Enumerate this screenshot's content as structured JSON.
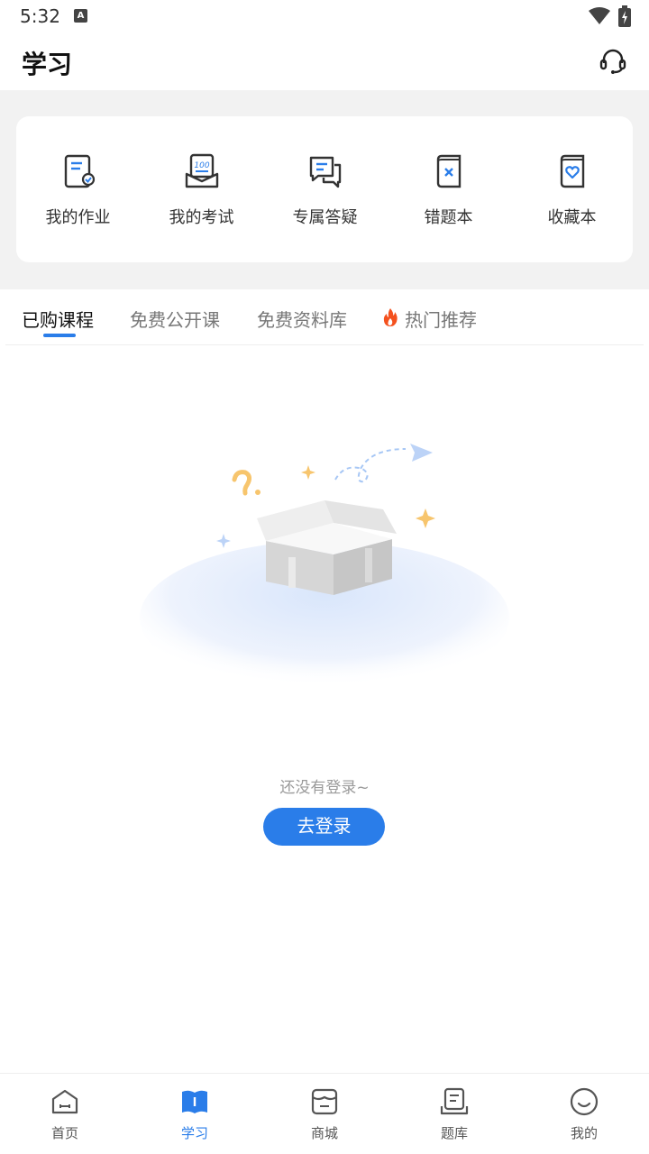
{
  "status_bar": {
    "time": "5:32",
    "notification_letter": "A"
  },
  "header": {
    "title": "学习",
    "service_icon": "headset-icon"
  },
  "tools": [
    {
      "label": "我的作业",
      "icon": "homework-icon"
    },
    {
      "label": "我的考试",
      "icon": "exam-icon"
    },
    {
      "label": "专属答疑",
      "icon": "qa-chat-icon"
    },
    {
      "label": "错题本",
      "icon": "wrong-questions-book-icon"
    },
    {
      "label": "收藏本",
      "icon": "favorites-book-icon"
    }
  ],
  "tabs": [
    {
      "label": "已购课程",
      "active": true
    },
    {
      "label": "免费公开课",
      "active": false
    },
    {
      "label": "免费资料库",
      "active": false
    },
    {
      "label": "热门推荐",
      "active": false,
      "icon": "fire-icon"
    }
  ],
  "empty_state": {
    "message": "还没有登录~",
    "button_label": "去登录"
  },
  "bottom_nav": [
    {
      "label": "首页",
      "icon": "home-icon",
      "active": false
    },
    {
      "label": "学习",
      "icon": "study-book-icon",
      "active": true
    },
    {
      "label": "商城",
      "icon": "store-icon",
      "active": false
    },
    {
      "label": "题库",
      "icon": "question-bank-icon",
      "active": false
    },
    {
      "label": "我的",
      "icon": "profile-smile-icon",
      "active": false
    }
  ],
  "colors": {
    "accent": "#2a7de9",
    "background_gray": "#f2f2f2",
    "text_primary": "#111111",
    "text_secondary": "#777777"
  }
}
